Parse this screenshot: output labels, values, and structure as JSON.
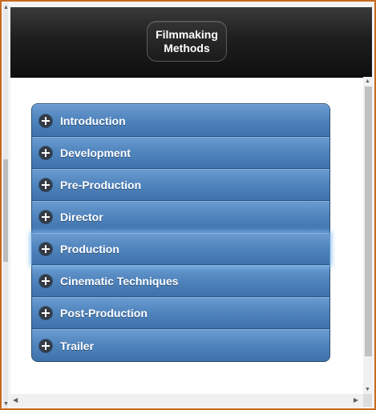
{
  "header": {
    "title": "Filmmaking\nMethods"
  },
  "accordion": {
    "items": [
      {
        "label": "Introduction",
        "icon": "plus-icon"
      },
      {
        "label": "Development",
        "icon": "plus-icon"
      },
      {
        "label": "Pre-Production",
        "icon": "plus-icon"
      },
      {
        "label": "Director",
        "icon": "plus-icon"
      },
      {
        "label": "Production",
        "icon": "plus-icon"
      },
      {
        "label": "Cinematic Techniques",
        "icon": "plus-icon"
      },
      {
        "label": "Post-Production",
        "icon": "plus-icon"
      },
      {
        "label": "Trailer",
        "icon": "plus-icon"
      }
    ],
    "active_index": 4
  },
  "colors": {
    "frame_border": "#c86a1e",
    "header_bg": "#1b1b1b",
    "accordion_blue": "#4f83bc",
    "active_glow": "#7fb8ef"
  }
}
